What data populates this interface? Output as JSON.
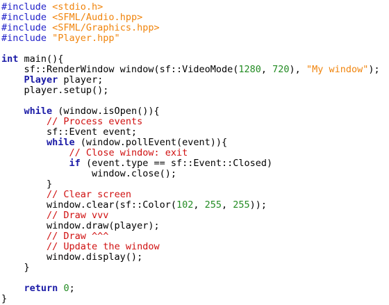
{
  "editor": {
    "language": "C++",
    "colors": {
      "background": "#ffffff",
      "preprocessor": "#1e1ec8",
      "string": "#f0840c",
      "keyword": "#1a1aa6",
      "number": "#228b22",
      "comment": "#d01010",
      "plain": "#000000"
    },
    "lines": [
      [
        {
          "t": "pp",
          "v": "#include "
        },
        {
          "t": "str",
          "v": "<stdio.h>"
        }
      ],
      [
        {
          "t": "pp",
          "v": "#include "
        },
        {
          "t": "str",
          "v": "<SFML/Audio.hpp>"
        }
      ],
      [
        {
          "t": "pp",
          "v": "#include "
        },
        {
          "t": "str",
          "v": "<SFML/Graphics.hpp>"
        }
      ],
      [
        {
          "t": "pp",
          "v": "#include "
        },
        {
          "t": "str",
          "v": "\"Player.hpp\""
        }
      ],
      [],
      [
        {
          "t": "kw",
          "v": "int"
        },
        {
          "t": "plain",
          "v": " main(){"
        }
      ],
      [
        {
          "t": "plain",
          "v": "    sf::RenderWindow window(sf::VideoMode("
        },
        {
          "t": "num",
          "v": "1280"
        },
        {
          "t": "plain",
          "v": ", "
        },
        {
          "t": "num",
          "v": "720"
        },
        {
          "t": "plain",
          "v": "), "
        },
        {
          "t": "str",
          "v": "\"My window\""
        },
        {
          "t": "plain",
          "v": ");"
        }
      ],
      [
        {
          "t": "plain",
          "v": "    "
        },
        {
          "t": "type",
          "v": "Player"
        },
        {
          "t": "plain",
          "v": " player;"
        }
      ],
      [
        {
          "t": "plain",
          "v": "    player.setup();"
        }
      ],
      [],
      [
        {
          "t": "plain",
          "v": "    "
        },
        {
          "t": "kw",
          "v": "while"
        },
        {
          "t": "plain",
          "v": " (window.isOpen()){"
        }
      ],
      [
        {
          "t": "plain",
          "v": "        "
        },
        {
          "t": "com",
          "v": "// Process events"
        }
      ],
      [
        {
          "t": "plain",
          "v": "        sf::Event event;"
        }
      ],
      [
        {
          "t": "plain",
          "v": "        "
        },
        {
          "t": "kw",
          "v": "while"
        },
        {
          "t": "plain",
          "v": " (window.pollEvent(event)){"
        }
      ],
      [
        {
          "t": "plain",
          "v": "            "
        },
        {
          "t": "com",
          "v": "// Close window: exit"
        }
      ],
      [
        {
          "t": "plain",
          "v": "            "
        },
        {
          "t": "kw",
          "v": "if"
        },
        {
          "t": "plain",
          "v": " (event.type == sf::Event::Closed)"
        }
      ],
      [
        {
          "t": "plain",
          "v": "                window.close();"
        }
      ],
      [
        {
          "t": "plain",
          "v": "        }"
        }
      ],
      [
        {
          "t": "plain",
          "v": "        "
        },
        {
          "t": "com",
          "v": "// Clear screen"
        }
      ],
      [
        {
          "t": "plain",
          "v": "        window.clear(sf::Color("
        },
        {
          "t": "num",
          "v": "102"
        },
        {
          "t": "plain",
          "v": ", "
        },
        {
          "t": "num",
          "v": "255"
        },
        {
          "t": "plain",
          "v": ", "
        },
        {
          "t": "num",
          "v": "255"
        },
        {
          "t": "plain",
          "v": "));"
        }
      ],
      [
        {
          "t": "plain",
          "v": "        "
        },
        {
          "t": "com",
          "v": "// Draw vvv"
        }
      ],
      [
        {
          "t": "plain",
          "v": "        window.draw(player);"
        }
      ],
      [
        {
          "t": "plain",
          "v": "        "
        },
        {
          "t": "com",
          "v": "// Draw ^^^"
        }
      ],
      [
        {
          "t": "plain",
          "v": "        "
        },
        {
          "t": "com",
          "v": "// Update the window"
        }
      ],
      [
        {
          "t": "plain",
          "v": "        window.display();"
        }
      ],
      [
        {
          "t": "plain",
          "v": "    }"
        }
      ],
      [],
      [
        {
          "t": "plain",
          "v": "    "
        },
        {
          "t": "kw",
          "v": "return"
        },
        {
          "t": "plain",
          "v": " "
        },
        {
          "t": "num",
          "v": "0"
        },
        {
          "t": "plain",
          "v": ";"
        }
      ],
      [
        {
          "t": "plain",
          "v": "}"
        }
      ]
    ]
  }
}
